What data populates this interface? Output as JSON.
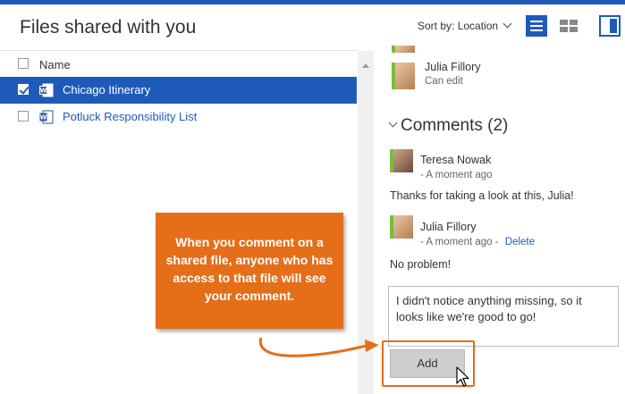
{
  "header": {
    "title": "Files shared with you",
    "sort_prefix": "Sort by:",
    "sort_value": "Location",
    "accent": "#1e5bb8"
  },
  "file_list": {
    "column_name": "Name",
    "rows": [
      {
        "name": "Chicago Itinerary",
        "selected": true,
        "icon": "word-doc-icon"
      },
      {
        "name": "Potluck Responsibility List",
        "selected": false,
        "icon": "word-doc-icon"
      }
    ]
  },
  "details": {
    "shared_user": {
      "name": "Julia Fillory",
      "permission": "Can edit"
    },
    "comments_header": "Comments (2)",
    "comments": [
      {
        "author": "Teresa Nowak",
        "time": "- A moment ago",
        "text": "Thanks for taking a look at this, Julia!"
      },
      {
        "author": "Julia Fillory",
        "time": "- A moment ago -",
        "action": "Delete",
        "text": "No problem!"
      }
    ],
    "comment_input": "I didn't notice anything missing, so it looks like we're good to go!",
    "add_label": "Add"
  },
  "callout": {
    "text": "When you comment on a shared file, anyone who has access to that file will see your comment.",
    "color": "#e56e19"
  }
}
